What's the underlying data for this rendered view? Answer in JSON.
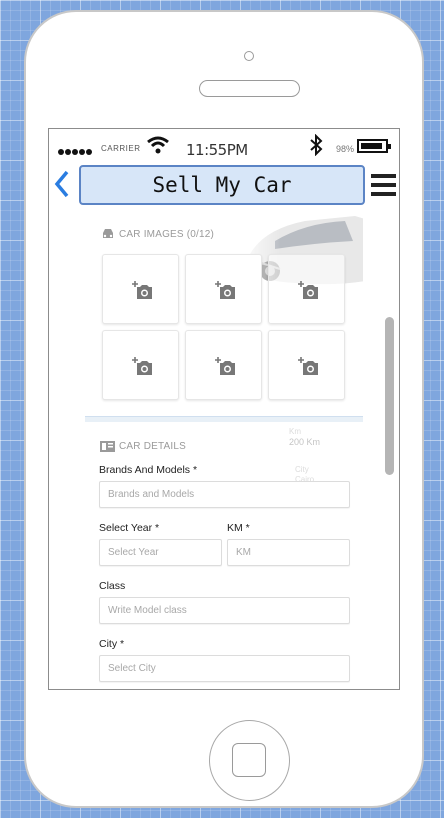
{
  "status_bar": {
    "carrier": "CARRIER",
    "time": "11:55PM",
    "battery_pct": "98%"
  },
  "header": {
    "title": "Sell My Car"
  },
  "car_images": {
    "label": "CAR IMAGES (0/12)",
    "slots": 6
  },
  "car_details": {
    "label": "CAR DETAILS",
    "brands": {
      "label": "Brands And Models *",
      "placeholder": "Brands and Models"
    },
    "year": {
      "label": "Select Year *",
      "placeholder": "Select Year"
    },
    "km": {
      "label": "KM *",
      "placeholder": "KM"
    },
    "class": {
      "label": "Class",
      "placeholder": "Write Model class"
    },
    "city": {
      "label": "City *",
      "placeholder": "Select City"
    }
  },
  "background_ghost": {
    "km_label": "Km",
    "km_value": "200 Km",
    "city_label": "City",
    "city_value": "Cairo"
  },
  "colors": {
    "accent": "#2a7de1",
    "title_bg": "#d7e6f8",
    "title_border": "#5b84c5"
  }
}
